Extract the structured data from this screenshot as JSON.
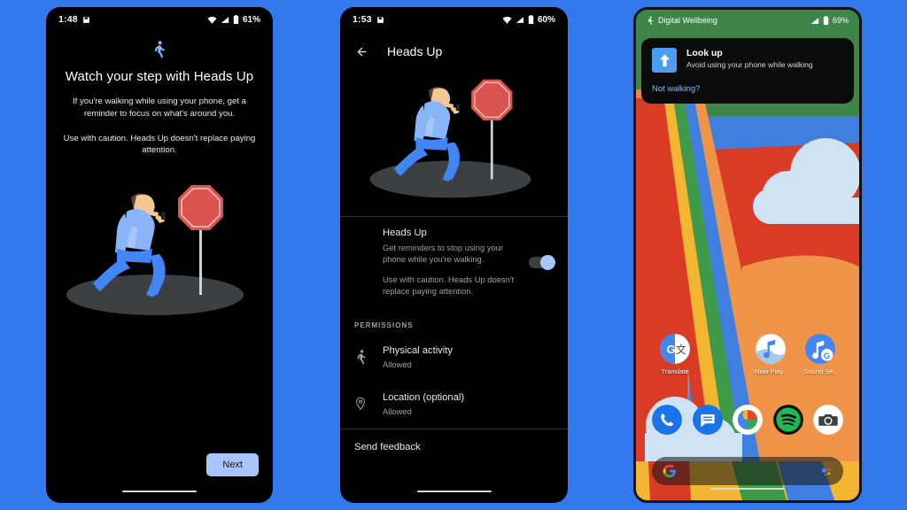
{
  "canvas": {
    "background_color": "#3478ed"
  },
  "phone1": {
    "name": "heads-up-onboarding",
    "status_bar": {
      "time": "1:48",
      "icons": [
        "save-icon",
        "wifi-icon",
        "signal-icon",
        "battery-icon"
      ],
      "battery": "61%"
    },
    "hero_icon": "walking-person-icon",
    "title": "Watch your step with Heads Up",
    "paragraph1": "If you're walking while using your phone, get a reminder to focus on what's around you.",
    "paragraph2": "Use with caution. Heads Up doesn't replace paying attention.",
    "illustration": "person-walking-with-phone-and-stop-sign",
    "next_label": "Next",
    "accent_color": "#a7c4fb"
  },
  "phone2": {
    "name": "heads-up-settings",
    "status_bar": {
      "time": "1:53",
      "icons": [
        "save-icon",
        "wifi-icon",
        "signal-icon",
        "battery-icon"
      ],
      "battery": "60%"
    },
    "appbar": {
      "back_icon": "arrow-back-icon",
      "title": "Heads Up"
    },
    "illustration": "person-walking-with-phone-and-stop-sign",
    "main_row": {
      "title": "Heads Up",
      "desc1": "Get reminders to stop using your phone while you're walking.",
      "desc2": "Use with caution. Heads Up doesn't replace paying attention.",
      "toggle_state": "on"
    },
    "section_label": "PERMISSIONS",
    "permissions": [
      {
        "icon": "running-person-icon",
        "title": "Physical activity",
        "status": "Allowed"
      },
      {
        "icon": "location-pin-icon",
        "title": "Location (optional)",
        "status": "Allowed"
      }
    ],
    "send_feedback": "Send feedback"
  },
  "phone3": {
    "name": "home-screen-with-notification",
    "status_bar": {
      "walking_icon": "walking-person-icon",
      "app_name": "Digital Wellbeing",
      "icons": [
        "signal-icon",
        "battery-icon"
      ],
      "battery": "69%",
      "background_color": "#3f854a"
    },
    "notification": {
      "icon": "look-up-arrow-icon",
      "title": "Look up",
      "text": "Avoid using your phone while walking",
      "action_label": "Not walking?",
      "action_color": "#8ab4f8"
    },
    "apps": [
      {
        "icon": "google-translate-icon",
        "label": "Translate"
      },
      {
        "icon": "now-playing-icon",
        "label": "Now Play.."
      },
      {
        "icon": "sound-search-icon",
        "label": "Sound Se.."
      }
    ],
    "dock": [
      {
        "icon": "phone-icon",
        "label": "Phone"
      },
      {
        "icon": "messages-icon",
        "label": "Messages"
      },
      {
        "icon": "google-photos-icon",
        "label": "Photos"
      },
      {
        "icon": "spotify-icon",
        "label": "Spotify"
      },
      {
        "icon": "camera-icon",
        "label": "Camera"
      }
    ],
    "search_bar": {
      "left_icon": "google-g-icon",
      "right_icon": "google-assistant-icon"
    }
  }
}
